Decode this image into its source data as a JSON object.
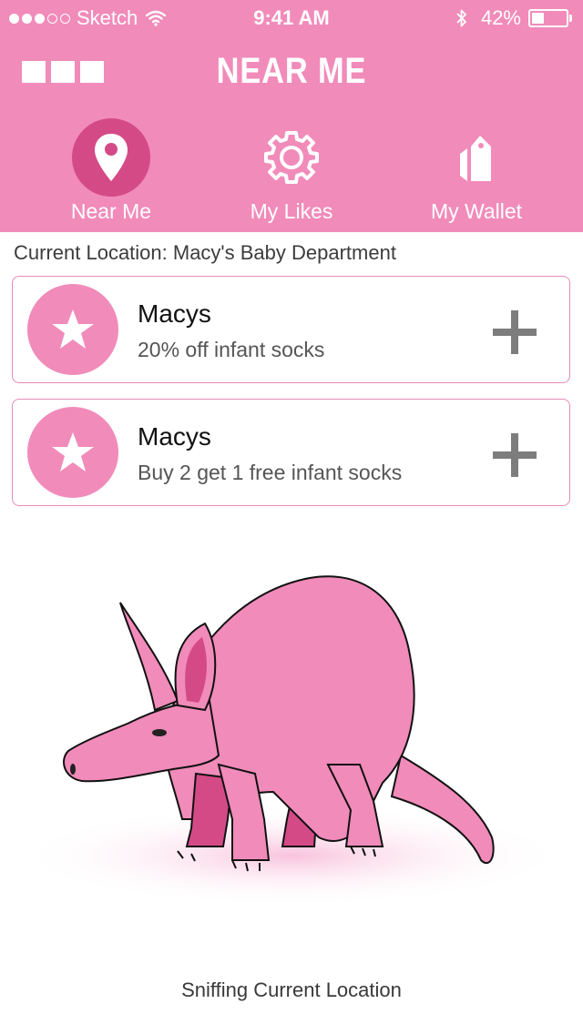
{
  "status_bar": {
    "carrier": "Sketch",
    "signal_full": 3,
    "signal_total": 5,
    "time": "9:41 AM",
    "battery_percent": "42%",
    "battery_level": 0.42
  },
  "header": {
    "title": "NEAR ME",
    "menu_icon": "menu-squares-icon",
    "background": "#f18bba",
    "tabs": [
      {
        "label": "Near Me",
        "icon": "map-pin-icon",
        "active": true
      },
      {
        "label": "My Likes",
        "icon": "gear-icon",
        "active": false
      },
      {
        "label": "My Wallet",
        "icon": "tag-icon",
        "active": false
      }
    ]
  },
  "location": {
    "text": "Current Location: Macy's Baby Department"
  },
  "deals": [
    {
      "title": "Macys",
      "description": "20% off infant socks",
      "icon": "star-icon"
    },
    {
      "title": "Macys",
      "description": "Buy 2 get 1 free infant socks",
      "icon": "star-icon"
    }
  ],
  "illustration": {
    "subject": "aardvark-illustration",
    "body_color": "#f18bba",
    "sock_color": "#d44a87"
  },
  "footer": {
    "caption": "Sniffing Current Location"
  }
}
